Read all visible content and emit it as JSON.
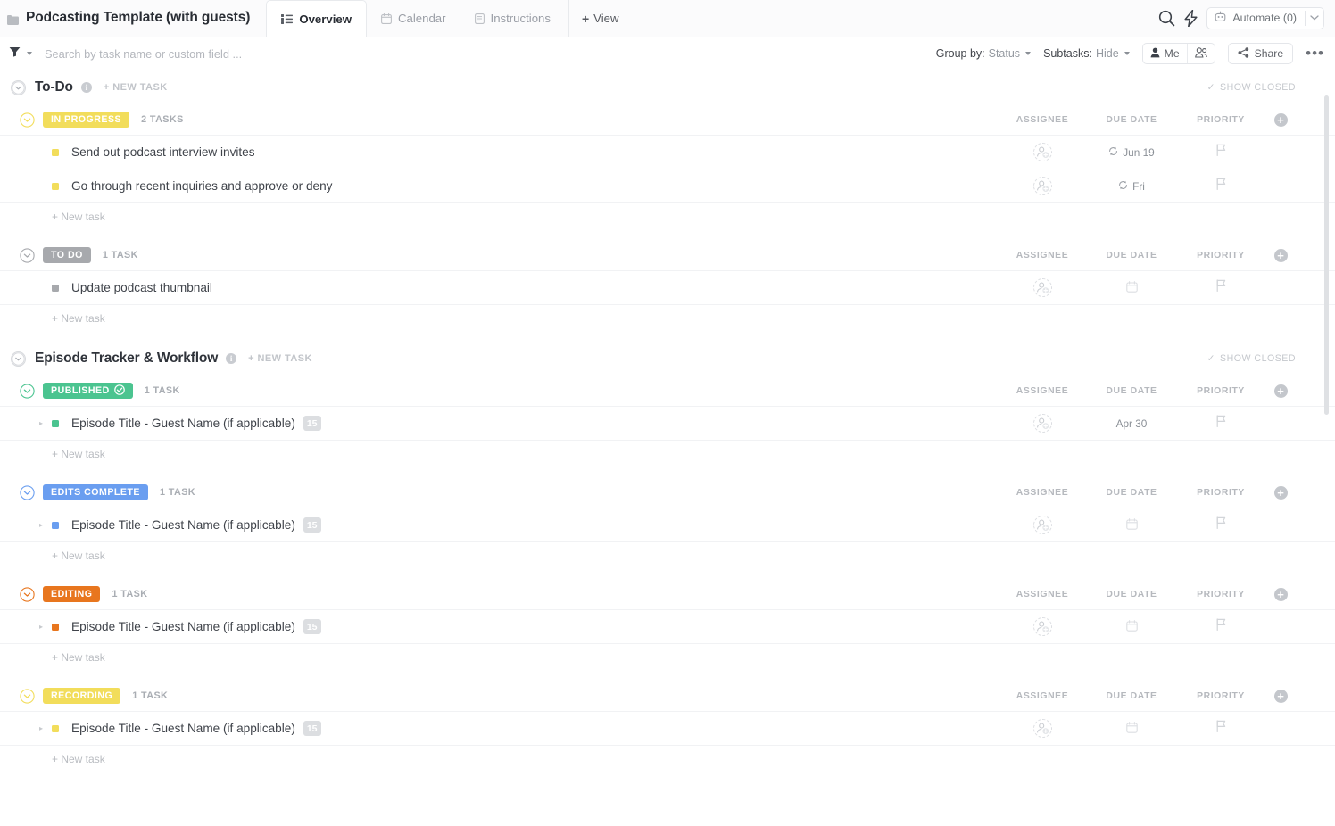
{
  "header": {
    "doc_icon": "folder-icon",
    "title": "Podcasting Template (with guests)",
    "tabs": [
      {
        "label": "Overview",
        "icon": "list-view-icon",
        "active": true
      },
      {
        "label": "Calendar",
        "icon": "calendar-icon",
        "active": false
      },
      {
        "label": "Instructions",
        "icon": "doc-icon",
        "active": false
      }
    ],
    "add_view_label": "View",
    "add_view_plus": "+",
    "search_icon": "search-icon",
    "bolt_icon": "lightning-bolt-icon",
    "automate_label": "Automate (0)",
    "automate_icon": "robot-icon",
    "automate_caret": "chevron-down-icon"
  },
  "toolbar": {
    "filter_icon": "filter-funnel-icon",
    "filter_caret": "chevron-down-icon",
    "search_placeholder": "Search by task name or custom field ...",
    "search_value": "",
    "group_by_label": "Group by:",
    "group_by_value": "Status",
    "subtasks_label": "Subtasks:",
    "subtasks_value": "Hide",
    "me_label": "Me",
    "me_icon": "person-icon",
    "people_icon": "people-icon",
    "share_label": "Share",
    "share_icon": "share-nodes-icon",
    "more_label": "•••"
  },
  "columns": {
    "assignee": "ASSIGNEE",
    "due_date": "DUE DATE",
    "priority": "PRIORITY",
    "add": "+"
  },
  "labels": {
    "show_closed": "SHOW CLOSED",
    "show_closed_check": "✓",
    "new_task_caps": "+ NEW TASK",
    "new_task": "+ New task",
    "expand_arrow": "▸"
  },
  "colors": {
    "in_progress": "#f2dd5b",
    "to_do": "#a7a9ad",
    "published": "#4bc490",
    "edits_complete": "#6a9ef0",
    "editing": "#e8761e",
    "recording": "#f2dd5b",
    "text_primary": "#2f333a",
    "text_muted": "#a9adb3"
  },
  "sections": [
    {
      "title": "To-Do",
      "info": "i",
      "groups": [
        {
          "status": "IN PROGRESS",
          "status_color": "#f2dd5b",
          "status_check": false,
          "count": "2 TASKS",
          "tasks": [
            {
              "title": "Send out podcast interview invites",
              "dot_color": "#f2dd5b",
              "expandable": false,
              "subtasks": "",
              "due": "Jun 19",
              "recurring": true
            },
            {
              "title": "Go through recent inquiries and approve or deny",
              "dot_color": "#f2dd5b",
              "expandable": false,
              "subtasks": "",
              "due": "Fri",
              "recurring": true
            }
          ]
        },
        {
          "status": "TO DO",
          "status_color": "#a7a9ad",
          "status_check": false,
          "count": "1 TASK",
          "tasks": [
            {
              "title": "Update podcast thumbnail",
              "dot_color": "#a7a9ad",
              "expandable": false,
              "subtasks": "",
              "due": "",
              "recurring": false
            }
          ]
        }
      ]
    },
    {
      "title": "Episode Tracker & Workflow",
      "info": "i",
      "groups": [
        {
          "status": "PUBLISHED",
          "status_color": "#4bc490",
          "status_check": true,
          "count": "1 TASK",
          "tasks": [
            {
              "title": "Episode Title - Guest Name (if applicable)",
              "dot_color": "#4bc490",
              "expandable": true,
              "subtasks": "15",
              "due": "Apr 30",
              "recurring": false
            }
          ]
        },
        {
          "status": "EDITS COMPLETE",
          "status_color": "#6a9ef0",
          "status_check": false,
          "count": "1 TASK",
          "tasks": [
            {
              "title": "Episode Title - Guest Name (if applicable)",
              "dot_color": "#6a9ef0",
              "expandable": true,
              "subtasks": "15",
              "due": "",
              "recurring": false
            }
          ]
        },
        {
          "status": "EDITING",
          "status_color": "#e8761e",
          "status_check": false,
          "count": "1 TASK",
          "tasks": [
            {
              "title": "Episode Title - Guest Name (if applicable)",
              "dot_color": "#e8761e",
              "expandable": true,
              "subtasks": "15",
              "due": "",
              "recurring": false
            }
          ]
        },
        {
          "status": "RECORDING",
          "status_color": "#f2dd5b",
          "status_check": false,
          "count": "1 TASK",
          "tasks": [
            {
              "title": "Episode Title - Guest Name (if applicable)",
              "dot_color": "#f2dd5b",
              "expandable": true,
              "subtasks": "15",
              "due": "",
              "recurring": false
            }
          ]
        }
      ]
    }
  ]
}
